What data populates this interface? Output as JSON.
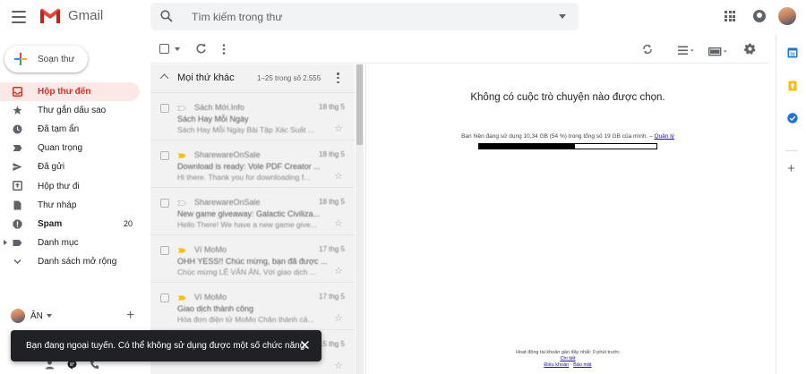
{
  "header": {
    "app_name": "Gmail",
    "search_placeholder": "Tìm kiếm trong thư"
  },
  "sidebar": {
    "compose_label": "Soạn thư",
    "items": [
      {
        "label": "Hộp thư đến",
        "icon": "inbox-icon",
        "active": true,
        "count": ""
      },
      {
        "label": "Thư gắn dấu sao",
        "icon": "star-icon",
        "count": ""
      },
      {
        "label": "Đã tạm ẩn",
        "icon": "clock-icon",
        "count": ""
      },
      {
        "label": "Quan trọng",
        "icon": "label-important-icon",
        "count": ""
      },
      {
        "label": "Đã gửi",
        "icon": "send-icon",
        "count": ""
      },
      {
        "label": "Hộp thư đi",
        "icon": "outbox-icon",
        "count": ""
      },
      {
        "label": "Thư nháp",
        "icon": "draft-icon",
        "count": ""
      },
      {
        "label": "Spam",
        "icon": "spam-icon",
        "count": "20",
        "bold": true
      },
      {
        "label": "Danh mục",
        "icon": "label-icon",
        "count": "",
        "expandable": true
      },
      {
        "label": "Danh sách mở rộng",
        "icon": "chevron-down-icon",
        "count": ""
      }
    ],
    "hangouts_user": "ÂN"
  },
  "snackbar": {
    "message": "Bạn đang ngoại tuyến. Có thể không sử dụng được một số chức năng."
  },
  "list": {
    "section_title": "Mọi thứ khác",
    "range": "1–25 trong số 2.555",
    "emails": [
      {
        "sender": "Sách Mới.Info",
        "date": "18 thg 5",
        "subject": "Sách Hay Mỗi Ngày",
        "snippet": "Sách Hay Mỗi Ngày Bài Tập Xác Suất ...",
        "important": false
      },
      {
        "sender": "SharewareOnSale",
        "date": "18 thg 5",
        "subject": "Download is ready: Vole PDF Creator ...",
        "snippet": "Hi there. Thank you for downloading f...",
        "important": true
      },
      {
        "sender": "SharewareOnSale",
        "date": "18 thg 5",
        "subject": "New game giveaway: Galactic Civiliza...",
        "snippet": "Hello There! We have a new game give...",
        "important": false
      },
      {
        "sender": "Ví MoMo",
        "date": "17 thg 5",
        "subject": "OHH YESS!! Chúc mừng, bạn đã được ...",
        "snippet": "Chúc mừng LÊ VĂN ÂN, Với giao dịch ...",
        "important": true
      },
      {
        "sender": "Ví MoMo",
        "date": "17 thg 5",
        "subject": "Giao dịch thành công",
        "snippet": "Hóa đơn điện tử MoMo Chân thành cả...",
        "important": true
      },
      {
        "sender": "",
        "date": "15 thg 5",
        "subject": "",
        "snippet": "",
        "important": false
      }
    ]
  },
  "reading": {
    "no_conversation": "Không có cuộc trò chuyện nào được chọn.",
    "storage_text": "Bạn hiện đang sử dụng 10,34 GB (54 %) trong tổng số 19 GB của mình. –",
    "manage_link": "Quản lý",
    "storage_fraction": 0.54,
    "last_activity": "Hoạt động tài khoản gần đây nhất: 0 phút trước",
    "details_link": "Chi tiết",
    "terms_link": "Điều khoản",
    "privacy_link": "Bảo mật",
    "separator": "·"
  },
  "colors": {
    "active_bg": "#fce8e6",
    "active_text": "#d93025",
    "important_tag": "#f4c20d"
  }
}
